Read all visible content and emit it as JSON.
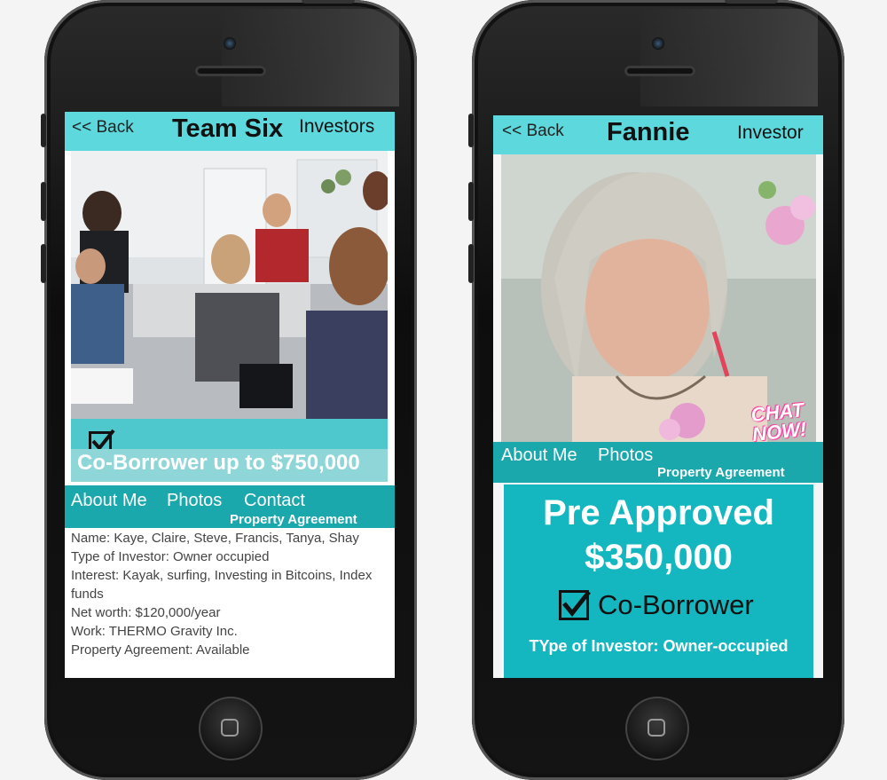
{
  "left_phone": {
    "header": {
      "back_label": "<< Back",
      "title": "Team Six",
      "role": "Investors"
    },
    "checkbox_checked": true,
    "banner_text": "Co-Borrower up to $750,000",
    "tabs": {
      "about": "About Me",
      "photos": "Photos",
      "contact": "Contact",
      "property_agreement": "Property Agreement"
    },
    "details": [
      "Name: Kaye, Claire, Steve, Francis, Tanya, Shay",
      "Type of Investor: Owner occupied",
      "Interest: Kayak, surfing, Investing in Bitcoins, Index",
      "funds",
      "Net worth: $120,000/year",
      "Work: THERMO Gravity Inc.",
      "Property Agreement: Available"
    ]
  },
  "right_phone": {
    "header": {
      "back_label": "<< Back",
      "title": "Fannie",
      "role": "Investor"
    },
    "chat_badge": {
      "line1": "CHAT",
      "line2": "NOW!"
    },
    "tabs": {
      "about": "About Me",
      "photos": "Photos",
      "property_agreement": "Property Agreement"
    },
    "approval": {
      "line1": "Pre Approved",
      "amount": "$350,000",
      "co_borrower": "Co-Borrower",
      "co_borrower_checked": true,
      "investor_type": "TYpe of Investor: Owner-occupied"
    }
  },
  "colors": {
    "accent": "#5dd8dc",
    "accent_dark": "#1aa8ad",
    "panel": "#14b7c0",
    "chat": "#ff3fa0"
  },
  "icons": [
    "checkbox-checked-icon",
    "home-button-square-icon"
  ]
}
